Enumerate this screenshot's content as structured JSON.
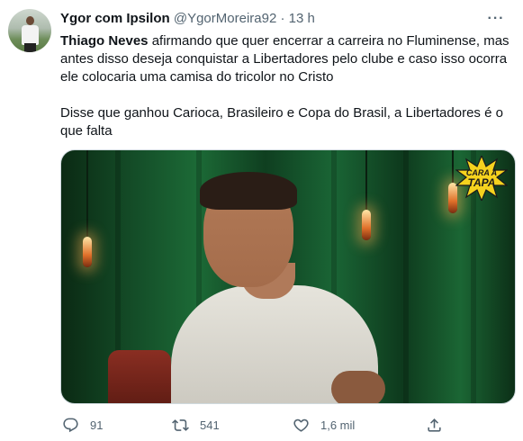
{
  "author": {
    "display_name": "Ygor com Ipsilon",
    "handle": "@YgorMoreira92",
    "separator": " · ",
    "time": "13 h"
  },
  "tweet": {
    "bold_lead": "Thiago Neves",
    "line1_rest": " afirmando que quer encerrar a carreira no Fluminense, mas antes disso deseja conquistar a Libertadores pelo clube e caso isso ocorra ele colocaria uma camisa do tricolor no Cristo",
    "paragraph2": "Disse que ganhou Carioca, Brasileiro e Copa do Brasil, a Libertadores é o que falta"
  },
  "media": {
    "logo_line1": "Cara a",
    "logo_line2": "Tapa"
  },
  "actions": {
    "reply": {
      "icon": "reply-icon",
      "count": "91"
    },
    "retweet": {
      "icon": "retweet-icon",
      "count": "541"
    },
    "like": {
      "icon": "heart-icon",
      "count": "1,6 mil"
    },
    "share": {
      "icon": "share-icon",
      "count": ""
    }
  },
  "colors": {
    "text": "#0f1419",
    "secondary": "#536471",
    "border": "#cfd9de"
  }
}
